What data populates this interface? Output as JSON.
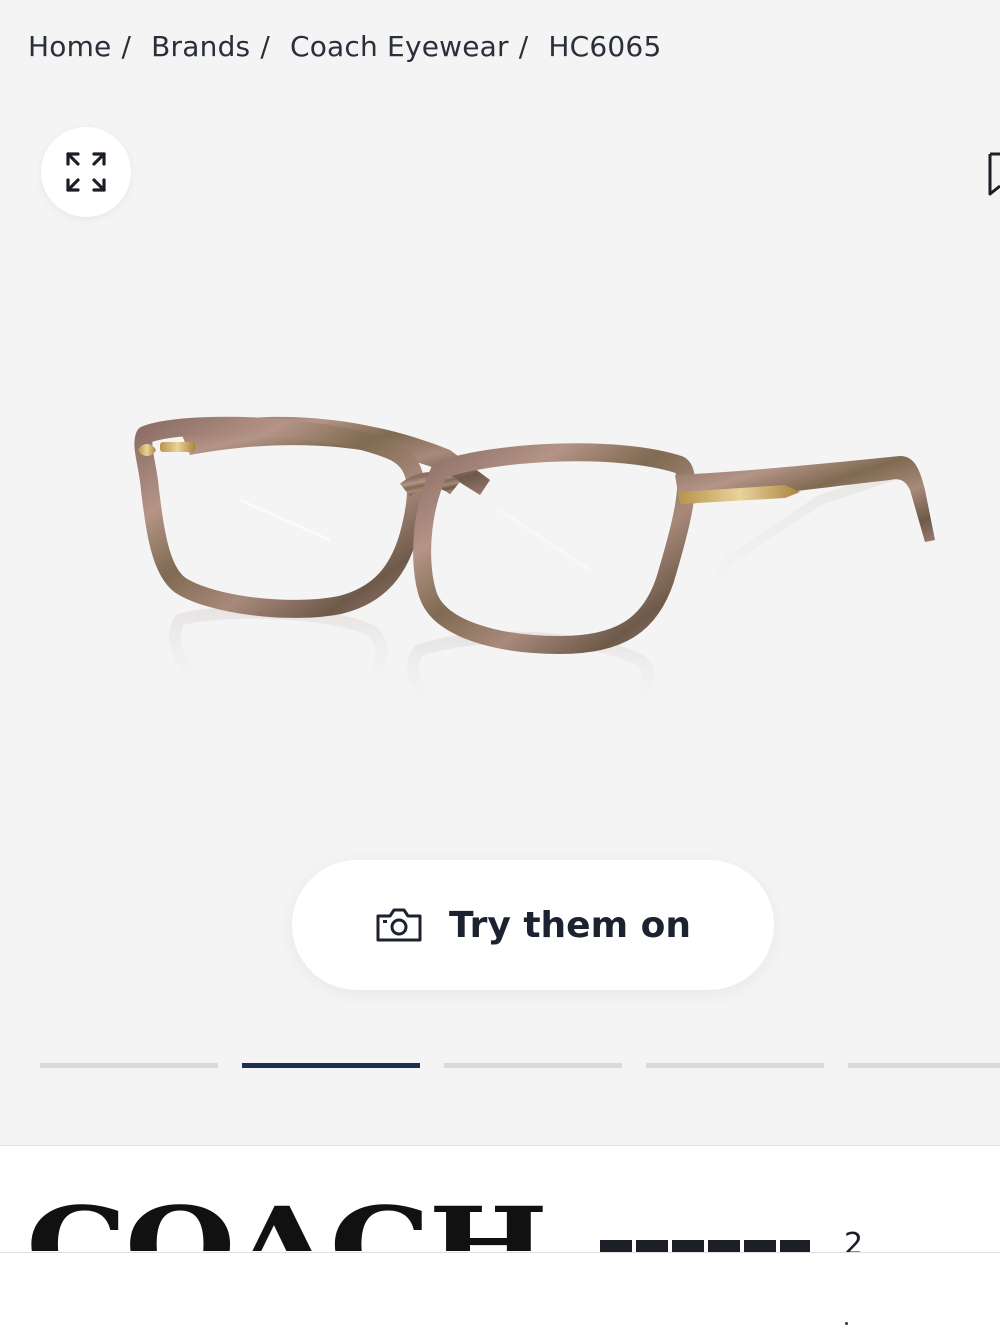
{
  "breadcrumb": {
    "items": [
      {
        "label": "Home",
        "sep": "/"
      },
      {
        "label": "Brands",
        "sep": "/"
      },
      {
        "label": "Coach Eyewear",
        "sep": "/"
      },
      {
        "label": "HC6065"
      }
    ]
  },
  "gallery": {
    "expand_icon": "expand-arrows-icon",
    "try_on_label": "Try them on",
    "try_on_icon": "camera-icon",
    "slides_total": 5,
    "active_slide": 2
  },
  "brand": {
    "logo_text": "COACH",
    "review_count": "2"
  },
  "colors": {
    "background": "#f4f4f5",
    "active_indicator": "#1e2f52",
    "inactive_indicator": "#d9dadd"
  }
}
